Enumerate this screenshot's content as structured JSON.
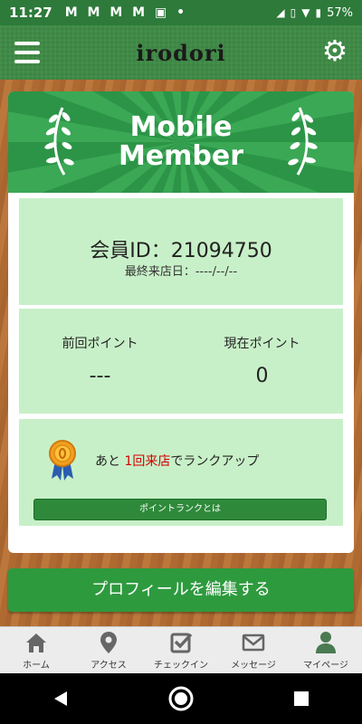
{
  "status_bar": {
    "time": "11:27",
    "notifications": "M M M M ▣ •",
    "battery": "57%"
  },
  "header": {
    "logo_text": "irodori",
    "menu_icon": "hamburger-menu-icon",
    "settings_icon": "gear-icon"
  },
  "card": {
    "banner_title_line1": "Mobile",
    "banner_title_line2": "Member",
    "member_id": "会員ID：21094750",
    "last_visit": "最終来店日：----/--/--",
    "previous_points_label": "前回ポイント",
    "previous_points_value": "---",
    "current_points_label": "現在ポイント",
    "current_points_value": "0",
    "rank_prefix": "あと ",
    "rank_highlight": "1回来店",
    "rank_suffix": "でランクアップ",
    "rank_button_label": "ポイントランクとは"
  },
  "edit_profile_label": "プロフィールを編集する",
  "bottom_nav": {
    "items": [
      {
        "label": "ホーム",
        "icon": "home-icon"
      },
      {
        "label": "アクセス",
        "icon": "map-pin-icon"
      },
      {
        "label": "チェックイン",
        "icon": "checkbox-icon"
      },
      {
        "label": "メッセージ",
        "icon": "envelope-icon"
      },
      {
        "label": "マイページ",
        "icon": "user-icon"
      }
    ]
  },
  "colors": {
    "brand_green": "#2e9a3e",
    "panel_green": "#c8f0c8",
    "highlight_red": "#d40000"
  }
}
